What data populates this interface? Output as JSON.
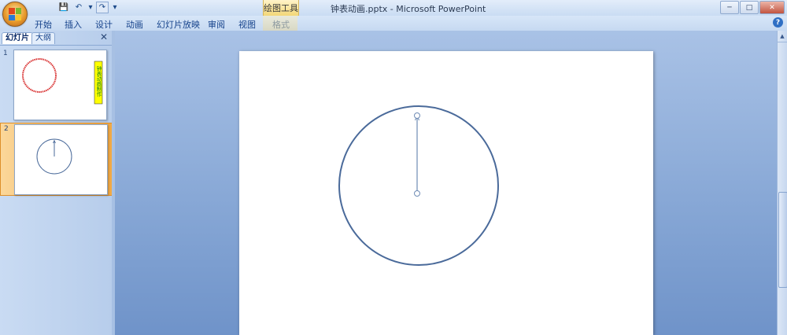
{
  "window": {
    "title": "钟表动画.pptx - Microsoft PowerPoint",
    "contextual_tab_group": "绘图工具"
  },
  "quick_access": [
    {
      "icon": "save-icon",
      "glyph": "💾"
    },
    {
      "icon": "undo-icon",
      "glyph": "↶"
    },
    {
      "icon": "undo-dropdown-icon",
      "glyph": "▾"
    },
    {
      "icon": "redo-icon",
      "glyph": "↷"
    },
    {
      "icon": "customize-qat-icon",
      "glyph": "▾"
    }
  ],
  "window_controls": {
    "minimize": "─",
    "maximize": "□",
    "close": "✕"
  },
  "ribbon_tabs": [
    "开始",
    "插入",
    "设计",
    "动画",
    "幻灯片放映",
    "审阅",
    "视图",
    "格式"
  ],
  "help": "?",
  "slides_panel": {
    "tab_slides": "幻灯片",
    "tab_outline": "大纲",
    "close": "✕",
    "slides": [
      {
        "number": "1",
        "selected": false,
        "textbox_text": "钟表动画制作"
      },
      {
        "number": "2",
        "selected": true
      }
    ]
  },
  "colors": {
    "clock_stroke": "#4a6a9a",
    "slide1_circle": "#d83030",
    "slide1_textbox_fill": "#ffff00",
    "slide1_text": "#0b7a1a",
    "selected_thumb": "#f2a944"
  }
}
